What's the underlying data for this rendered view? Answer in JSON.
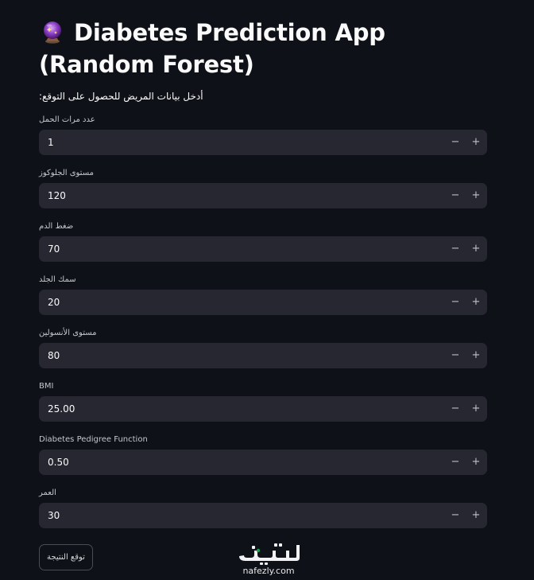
{
  "app": {
    "title": "Diabetes Prediction App (Random Forest)",
    "title_icon": "crystal-ball-icon",
    "instruction": "أدخل بيانات المريض للحصول على التوقع:"
  },
  "fields": [
    {
      "label": "عدد مرات الحمل",
      "value": "1"
    },
    {
      "label": "مستوى الجلوكوز",
      "value": "120"
    },
    {
      "label": "ضغط الدم",
      "value": "70"
    },
    {
      "label": "سمك الجلد",
      "value": "20"
    },
    {
      "label": "مستوى الأنسولين",
      "value": "80"
    },
    {
      "label": "BMI",
      "value": "25.00"
    },
    {
      "label": "Diabetes Pedigree Function",
      "value": "0.50"
    },
    {
      "label": "العمر",
      "value": "30"
    }
  ],
  "stepper": {
    "minus": "−",
    "plus": "+"
  },
  "submit_label": "توقع النتيجة",
  "watermark": {
    "text": "nafezly.com",
    "logo_icon": "nafezly-logo-icon"
  },
  "colors": {
    "background": "#0e1117",
    "input_bg": "#262730",
    "text": "#fafafa"
  }
}
